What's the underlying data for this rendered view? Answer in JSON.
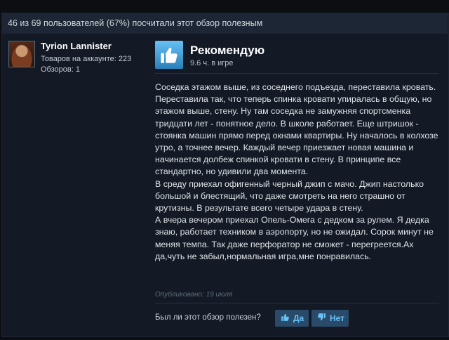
{
  "helpful_summary": "46 из 69 пользователей (67%) посчитали этот обзор полезным",
  "author": {
    "name": "Tyrion Lannister",
    "products_label": "Товаров на аккаунте: 223",
    "reviews_label": "Обзоров: 1"
  },
  "review": {
    "verdict": "Рекомендую",
    "hours": "9.6 ч. в игре",
    "text": "Соседка этажом выше, из соседнего подъезда, переставила кровать. Переставила так, что теперь спинка кровати упиралась в общую, но этажом выше, стену. Ну там соседка не замужняя спортсменка тридцати лет - понятное дело. В школе работает. Еще штришок - стоянка машин прямо перед окнами квартиры. Ну началось в колхозе утро, а точнее вечер. Каждый вечер приезжает новая машина и начинается долбеж спинкой кровати в стену. В принципе все стандартно, но удивили два момента.\nВ среду приехал офигенный черный джип с мачо. Джип настолько большой и блестящий, что даже смотреть на него страшно от крутизны. В результате всего четыре удара в стену.\nА вчера вечером приехал Опель-Омега с дедком за рулем. Я дедка знаю, работает техником в аэропорту, но не ожидал. Сорок минут не меняя темпа. Так даже перфоратор не сможет - перегреется.Ах да,чуть не забыл,нормальная игра,мне понравилась.",
    "posted": "Опубликовано: 19 июля"
  },
  "feedback": {
    "question": "Был ли этот обзор полезен?",
    "yes_label": "Да",
    "no_label": "Нет"
  },
  "colors": {
    "accent": "#67c1f5",
    "button_bg": "#2a4a69",
    "panel_bg": "#131a25"
  },
  "icons": {
    "recommend": "thumbs-up-icon",
    "yes": "thumbs-up-icon",
    "no": "thumbs-down-icon"
  }
}
